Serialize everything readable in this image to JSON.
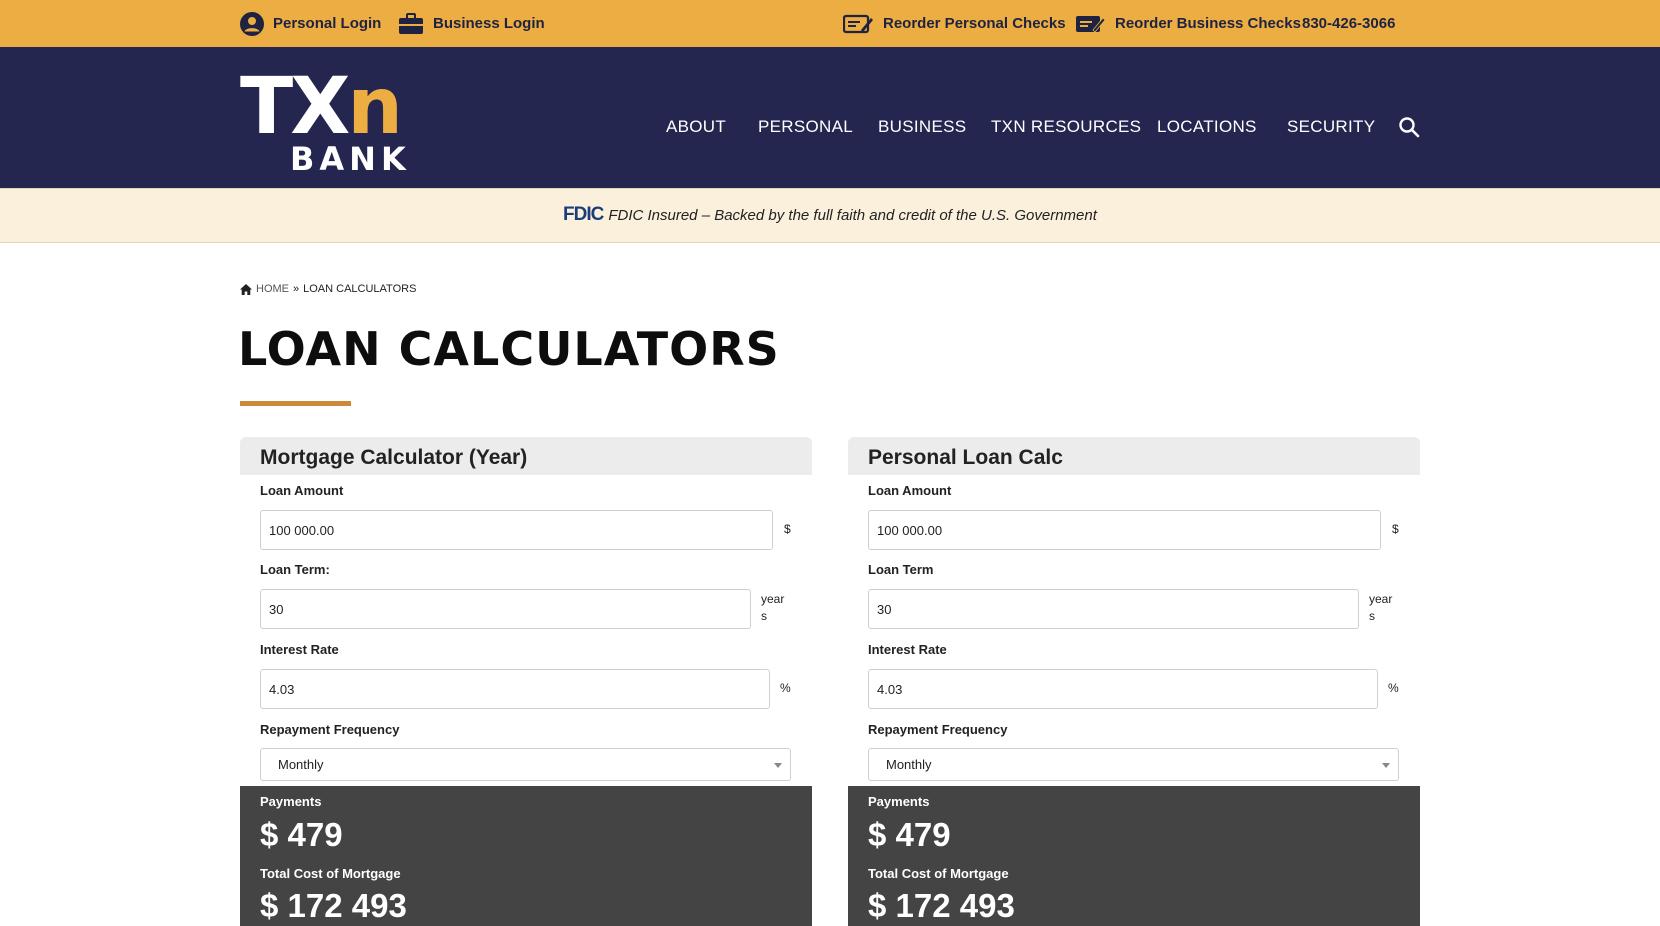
{
  "topbar": {
    "personal_login": "Personal Login",
    "business_login": "Business Login",
    "reorder_personal": "Reorder Personal Checks",
    "reorder_business": "Reorder Business Checks",
    "phone": "830-426-3066"
  },
  "brand": {
    "logo_top_left": "TX",
    "logo_top_right": "n",
    "logo_bottom": "BANK",
    "accent_color": "#ecad43",
    "navy_color": "#24264f"
  },
  "nav": {
    "items": [
      {
        "label": "ABOUT"
      },
      {
        "label": "PERSONAL"
      },
      {
        "label": "BUSINESS"
      },
      {
        "label": "TXN RESOURCES"
      },
      {
        "label": "LOCATIONS"
      },
      {
        "label": "SECURITY"
      }
    ],
    "search_icon": "search-icon"
  },
  "notice": {
    "fdic_logo": "FDIC",
    "text": "FDIC Insured – Backed by the full faith and credit of the U.S. Government"
  },
  "breadcrumb": {
    "home": "HOME",
    "separator": "»",
    "current": "LOAN CALCULATORS"
  },
  "page": {
    "title": "LOAN CALCULATORS"
  },
  "calculators": [
    {
      "title": "Mortgage Calculator (Year)",
      "loan_amount_label": "Loan Amount",
      "loan_amount_value": "100 000.00",
      "loan_amount_unit": "$",
      "loan_term_label": "Loan Term:",
      "loan_term_value": "30",
      "loan_term_unit_line1": "year",
      "loan_term_unit_line2": "s",
      "interest_label": "Interest Rate",
      "interest_value": "4.03",
      "interest_unit": "%",
      "frequency_label": "Repayment Frequency",
      "frequency_value": "Monthly",
      "payments_label": "Payments",
      "payments_value": "$ 479",
      "total_label": "Total Cost of Mortgage",
      "total_value": "$ 172 493"
    },
    {
      "title": "Personal Loan Calc",
      "loan_amount_label": "Loan Amount",
      "loan_amount_value": "100 000.00",
      "loan_amount_unit": "$",
      "loan_term_label": "Loan Term",
      "loan_term_value": "30",
      "loan_term_unit_line1": "year",
      "loan_term_unit_line2": "s",
      "interest_label": "Interest Rate",
      "interest_value": "4.03",
      "interest_unit": "%",
      "frequency_label": "Repayment Frequency",
      "frequency_value": "Monthly",
      "payments_label": "Payments",
      "payments_value": "$ 479",
      "total_label": "Total Cost of Mortgage",
      "total_value": "$ 172 493"
    }
  ]
}
